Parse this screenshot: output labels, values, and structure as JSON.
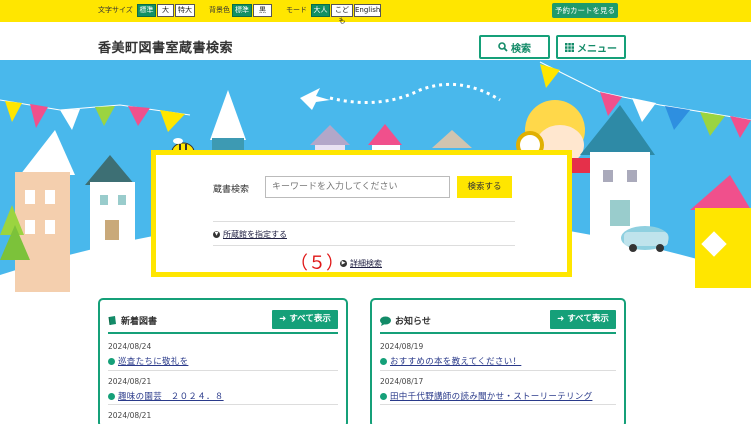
{
  "topbar": {
    "font_size_label": "文字サイズ",
    "font_sizes": [
      "標準",
      "大",
      "特大"
    ],
    "bg_color_label": "背景色",
    "bg_colors": [
      "標準",
      "黒"
    ],
    "mode_label": "モード",
    "modes": [
      "大人",
      "こども",
      "English"
    ],
    "cart_label": "予約カートを見る"
  },
  "header": {
    "title": "香美町図書室蔵書検索",
    "search_label": "検索",
    "menu_label": "メニュー"
  },
  "search": {
    "label": "蔵書検索",
    "placeholder": "キーワードを入力してください",
    "button": "検索する",
    "library_link": "所蔵館を指定する",
    "advanced_link": "詳細検索",
    "callout": "（５）"
  },
  "new_books": {
    "title": "新着図書",
    "show_all": "すべて表示",
    "items": [
      {
        "date": "2024/08/24",
        "title": "巡査たちに敬礼を"
      },
      {
        "date": "2024/08/21",
        "title": "趣味の園芸　２０２４．８"
      },
      {
        "date": "2024/08/21",
        "title": ""
      }
    ]
  },
  "news": {
    "title": "お知らせ",
    "show_all": "すべて表示",
    "items": [
      {
        "date": "2024/08/19",
        "title": "おすすめの本を教えてください！"
      },
      {
        "date": "2024/08/17",
        "title": "田中千代野講師の読み聞かせ・ストーリーテリング"
      }
    ]
  },
  "colors": {
    "accent": "#15a079",
    "yellow": "#ffe600",
    "sky": "#49b8ec"
  }
}
